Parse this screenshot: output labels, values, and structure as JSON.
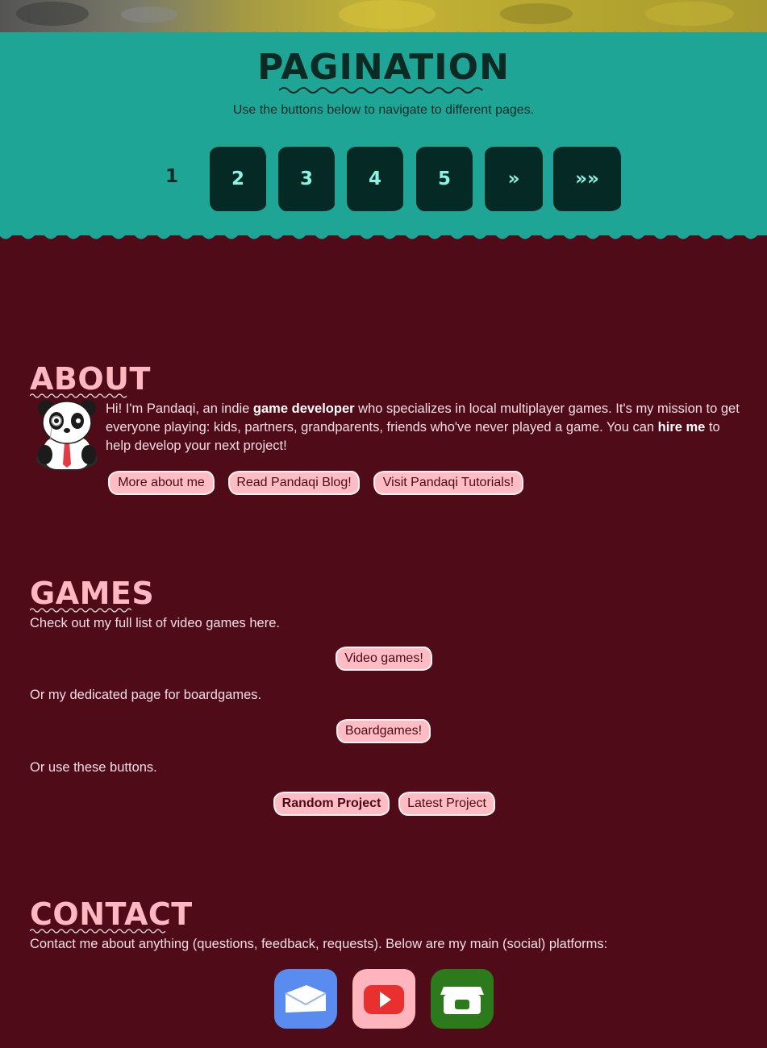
{
  "pagination": {
    "title": "PAGINATION",
    "subtitle": "Use the buttons below to navigate to different pages.",
    "current_page": "1",
    "pages": [
      "2",
      "3",
      "4",
      "5"
    ],
    "next_label": "»",
    "last_label": "»»"
  },
  "about": {
    "title": "ABOUT",
    "text_part1": "Hi! I'm Pandaqi, an indie ",
    "text_bold1": "game developer",
    "text_part2": " who specializes in local multiplayer games. It's my mission to get everyone playing: kids, partners, grandparents, friends who've never played a game. You can ",
    "text_bold2": "hire me",
    "text_part3": " to help develop your next project!",
    "buttons": [
      "More about me",
      "Read Pandaqi Blog!",
      "Visit Pandaqi Tutorials!"
    ]
  },
  "games": {
    "title": "GAMES",
    "line1": "Check out my full list of video games here.",
    "button1": "Video games!",
    "line2": "Or my dedicated page for boardgames.",
    "button2": "Boardgames!",
    "line3": "Or use these buttons.",
    "button_random": "Random Project",
    "button_latest": "Latest Project"
  },
  "contact": {
    "title": "CONTACT",
    "text": "Contact me about anything (questions, feedback, requests). Below are my main (social) platforms:",
    "platforms": [
      {
        "icon": "mail-icon",
        "color": "#5a8cf0"
      },
      {
        "icon": "youtube-icon",
        "color": "#ffb5bd"
      },
      {
        "icon": "itch-icon",
        "color": "#2d7a1c"
      }
    ]
  },
  "colors": {
    "teal": "#1fa595",
    "maroon": "#4f0c18",
    "pink": "#ffbcc5",
    "dark_teal": "#052a25"
  }
}
